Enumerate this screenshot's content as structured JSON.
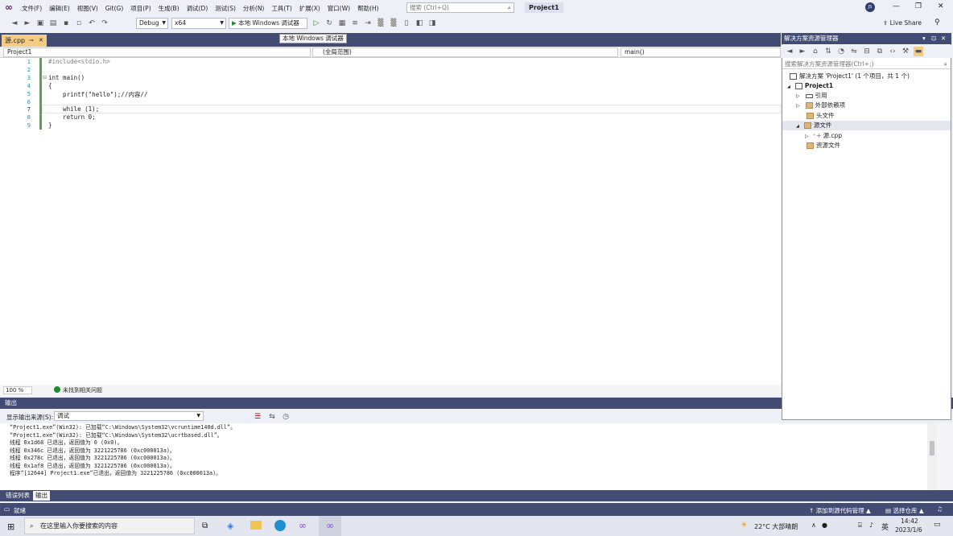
{
  "menu": {
    "items": [
      "文件(F)",
      "编辑(E)",
      "视图(V)",
      "Git(G)",
      "项目(P)",
      "生成(B)",
      "调试(D)",
      "测试(S)",
      "分析(N)",
      "工具(T)",
      "扩展(X)",
      "窗口(W)",
      "帮助(H)"
    ],
    "search_placeholder": "搜索 (Ctrl+Q)",
    "project_badge": "Project1",
    "avatar_initials": "JS",
    "live_share": "Live Share"
  },
  "toolbar": {
    "config": "Debug",
    "platform": "x64",
    "run_label": "本地 Windows 调试器",
    "tooltip": "本地 Windows 调试器"
  },
  "editor": {
    "tab_label": "源.cpp",
    "nav_project": "Project1",
    "nav_scope": "(全局范围)",
    "nav_member": "main()",
    "line_numbers": [
      "1",
      "2",
      "3",
      "4",
      "5",
      "6",
      "7",
      "8",
      "9"
    ],
    "lines": [
      "#include<stdio.h>",
      "",
      "int main()",
      "{",
      "    printf(\"hello\");//内容//",
      "",
      "    while (1);",
      "    return 0;",
      "}"
    ],
    "zoom": "100 %",
    "issues": "未找到相关问题"
  },
  "output": {
    "title": "输出",
    "source_label": "显示输出来源(S):",
    "source_value": "调试",
    "lines": [
      "“Project1.exe”(Win32): 已加载“C:\\Windows\\System32\\vcruntime140d.dll”。",
      "“Project1.exe”(Win32): 已加载“C:\\Windows\\System32\\ucrtbased.dll”。",
      "线程 0x1d68 已退出，返回值为 0 (0x0)。",
      "线程 0x346c 已退出，返回值为 3221225786 (0xc000013a)。",
      "线程 0x278c 已退出，返回值为 3221225786 (0xc000013a)。",
      "线程 0x1af8 已退出，返回值为 3221225786 (0xc000013a)。",
      "程序“[12644] Project1.exe”已退出，返回值为 3221225786 (0xc000013a)。"
    ]
  },
  "bottom_tabs": [
    "错误列表",
    "输出"
  ],
  "status": {
    "ready": "就绪",
    "add_source_control": "添加到源代码管理",
    "select_repo": "选择仓库"
  },
  "solution_explorer": {
    "title": "解决方案资源管理器",
    "search_placeholder": "搜索解决方案资源管理器(Ctrl+;)",
    "solution_label": "解决方案 'Project1' (1 个项目，共 1 个)",
    "project": "Project1",
    "nodes": [
      "引用",
      "外部依赖项",
      "头文件",
      "源文件",
      "源.cpp",
      "资源文件"
    ]
  },
  "taskbar": {
    "search_placeholder": "在这里输入你要搜索的内容",
    "weather": "22°C 大部晴朗",
    "ime": "英",
    "time": "14:42",
    "date": "2023/1/6"
  },
  "colors": {
    "accent": "#414b73",
    "tab_active": "#f5cc84",
    "gutter_green": "#57a64a",
    "keyword": "#1e1e1e",
    "linenum": "#2b91af"
  }
}
